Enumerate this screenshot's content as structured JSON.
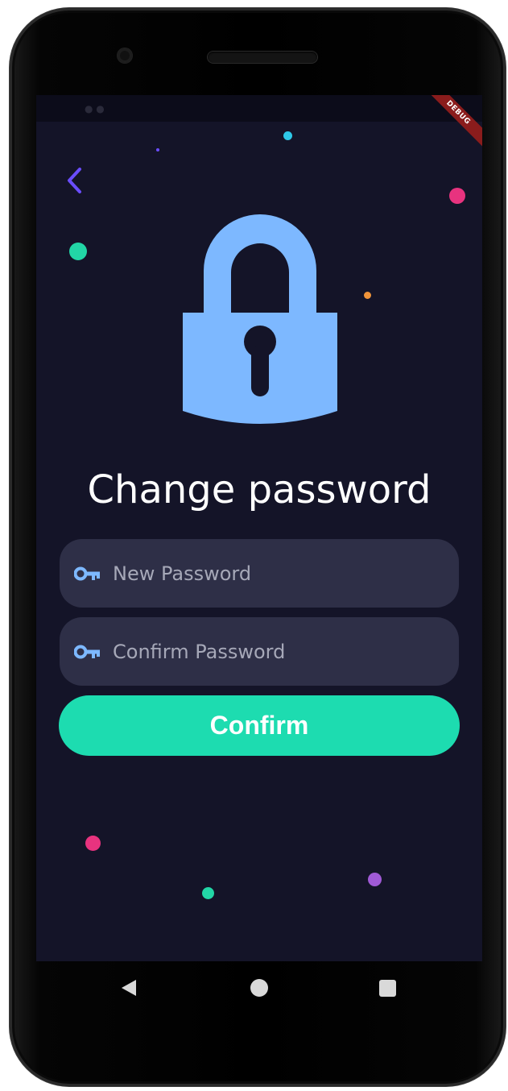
{
  "screen": {
    "title": "Change password",
    "debug_banner": "DEBUG"
  },
  "form": {
    "new_password": {
      "placeholder": "New Password",
      "value": ""
    },
    "confirm_password": {
      "placeholder": "Confirm Password",
      "value": ""
    },
    "confirm_label": "Confirm"
  },
  "icons": {
    "back": "chevron-left-icon",
    "lock": "lock-icon",
    "key": "key-icon",
    "nav_back": "triangle-back-icon",
    "nav_home": "circle-home-icon",
    "nav_recent": "square-recents-icon"
  },
  "colors": {
    "background": "#141428",
    "field_background": "#2e2f47",
    "accent": "#1ddcb0",
    "lock": "#7db8ff",
    "back_chevron": "#6a4dff",
    "confetti_pink": "#e8337f",
    "confetti_teal": "#22d6a6",
    "confetti_cyan": "#2ec8e8",
    "confetti_orange": "#f0943a",
    "confetti_purple": "#a05ad6"
  }
}
